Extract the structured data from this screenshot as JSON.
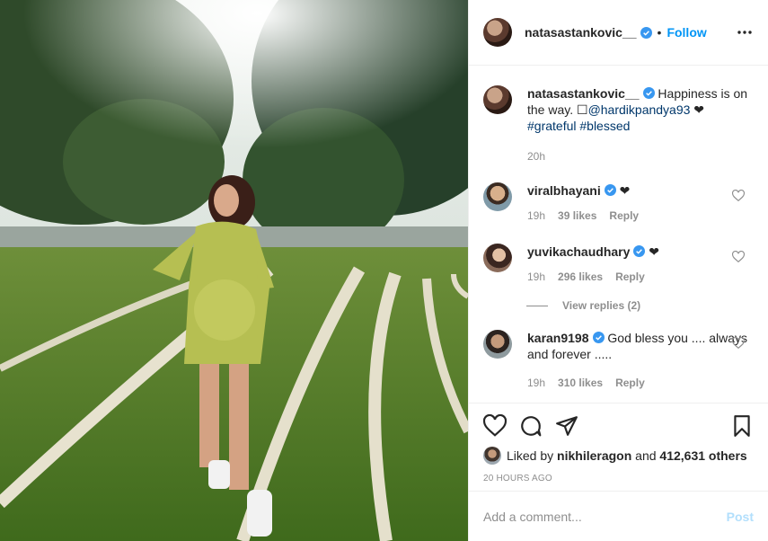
{
  "post": {
    "username": "natasastankovic__",
    "follow_label": "Follow",
    "separator": "•"
  },
  "caption": {
    "username": "natasastankovic__",
    "text_1": "Happiness is on the way. ",
    "glyph": "☐",
    "mention": "@hardikpandya93",
    "heart": " ❤",
    "hashtag_1": "#grateful",
    "hashtag_2": "#blessed",
    "time": "20h"
  },
  "comments": [
    {
      "username": "viralbhayani",
      "text": "❤",
      "time": "19h",
      "likes": "39 likes",
      "reply": "Reply"
    },
    {
      "username": "yuvikachaudhary",
      "text": "❤",
      "time": "19h",
      "likes": "296 likes",
      "reply": "Reply"
    },
    {
      "username": "karan9198",
      "text": "God bless you .... always and forever .....",
      "time": "19h",
      "likes": "310 likes",
      "reply": "Reply"
    }
  ],
  "view_replies": "View replies (2)",
  "likes": {
    "prefix": "Liked by ",
    "user": "nikhileragon",
    "middle": " and ",
    "count": "412,631 others"
  },
  "timestamp": "20 HOURS AGO",
  "add_comment": {
    "placeholder": "Add a comment...",
    "post_label": "Post"
  },
  "colors": {
    "link": "#0095f6",
    "verified": "#3897f0",
    "muted": "#8e8e8e",
    "post_disabled": "#b2dffc"
  }
}
